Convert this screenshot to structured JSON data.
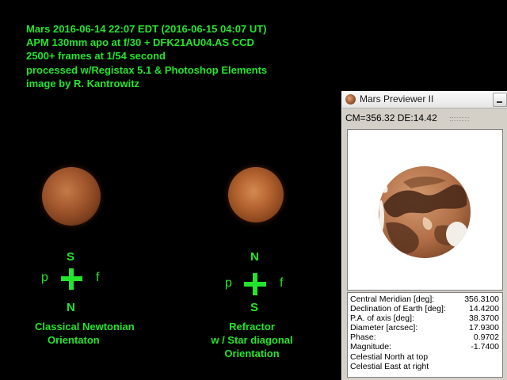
{
  "caption": {
    "line1": "Mars 2016-06-14 22:07 EDT (2016-06-15 04:07 UT)",
    "line2": "APM 130mm apo at f/30 + DFK21AU04.AS CCD",
    "line3": "2500+ frames at 1/54 second",
    "line4": "processed w/Registax 5.1 & Photoshop Elements",
    "line5": "image by R. Kantrowitz"
  },
  "left_orientation": {
    "top": "S",
    "bottom": "N",
    "left": "p",
    "right": "f",
    "title_line1": "Classical Newtonian",
    "title_line2": "Orientaton"
  },
  "right_orientation": {
    "top": "N",
    "bottom": "S",
    "left": "p",
    "right": "f",
    "title_line1": "Refractor",
    "title_line2": "w / Star diagonal",
    "title_line3": "Orientation"
  },
  "colors": {
    "label_green": "#22e52c",
    "background": "#000000",
    "window_face": "#d4d0c8"
  },
  "previewer": {
    "title": "Mars Previewer II",
    "cm_line": "CM=356.32 DE:14.42",
    "info": [
      {
        "label": "Central Meridian [deg]:",
        "value": "356.3100"
      },
      {
        "label": "Declination of Earth [deg]:",
        "value": "14.4200"
      },
      {
        "label": "P.A. of axis [deg]:",
        "value": "38.3700"
      },
      {
        "label": "Diameter [arcsec]:",
        "value": "17.9300"
      },
      {
        "label": "Phase:",
        "value": "0.9702"
      },
      {
        "label": "Magnitude:",
        "value": "-1.7400"
      }
    ],
    "note1": "Celestial North at top",
    "note2": "Celestial East at right"
  }
}
